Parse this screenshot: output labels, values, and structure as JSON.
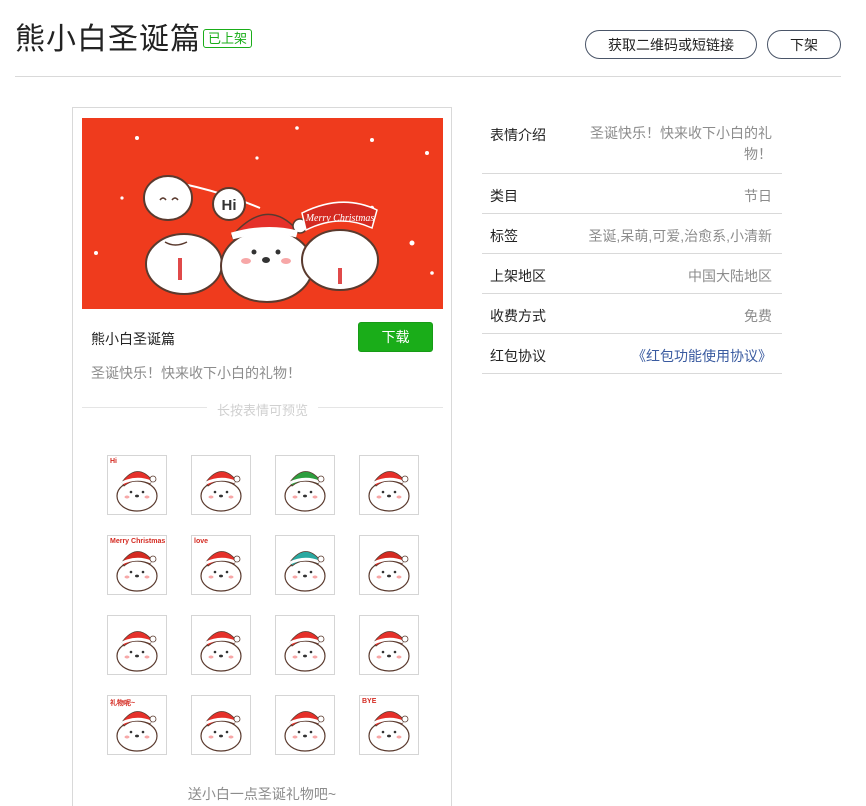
{
  "header": {
    "title": "熊小白圣诞篇",
    "status": "已上架",
    "qrcode_button": "获取二维码或短链接",
    "offline_button": "下架"
  },
  "card": {
    "banner": {
      "bubble_text": "Hi",
      "ribbon_text": "Merry Christmas",
      "background_color": "#ef3b1d"
    },
    "pack_name": "熊小白圣诞篇",
    "download_button": "下载",
    "description": "圣诞快乐！快来收下小白的礼物！",
    "preview_hint": "长按表情可预览",
    "footer_note": "送小白一点圣诞礼物吧~",
    "stickers": [
      {
        "name": "sticker-hi-bear-icon",
        "text": "Hi"
      },
      {
        "name": "sticker-gift-bear-icon",
        "text": ""
      },
      {
        "name": "sticker-tree-bear-icon",
        "text": ""
      },
      {
        "name": "sticker-reindeer-bear-icon",
        "text": ""
      },
      {
        "name": "sticker-merry-christmas-bear-icon",
        "text": "Merry Christmas"
      },
      {
        "name": "sticker-love-balloon-bear-icon",
        "text": "love"
      },
      {
        "name": "sticker-scarf-bear-icon",
        "text": ""
      },
      {
        "name": "sticker-santa-bear-icon",
        "text": ""
      },
      {
        "name": "sticker-antler-bear-icon",
        "text": ""
      },
      {
        "name": "sticker-antler-sign-bear-icon",
        "text": ""
      },
      {
        "name": "sticker-sleeping-bag-bear-icon",
        "text": ""
      },
      {
        "name": "sticker-dots-bear-icon",
        "text": ""
      },
      {
        "name": "sticker-thanks-bear-icon",
        "text": "礼物呢~"
      },
      {
        "name": "sticker-reindeer-nose-bear-icon",
        "text": ""
      },
      {
        "name": "sticker-ornament-bear-icon",
        "text": ""
      },
      {
        "name": "sticker-bye-bear-icon",
        "text": "BYE"
      }
    ]
  },
  "info": {
    "rows": [
      {
        "label": "表情介绍",
        "value": "圣诞快乐！快来收下小白的礼物！"
      },
      {
        "label": "类目",
        "value": "节日"
      },
      {
        "label": "标签",
        "value": "圣诞,呆萌,可爱,治愈系,小清新"
      },
      {
        "label": "上架地区",
        "value": "中国大陆地区"
      },
      {
        "label": "收费方式",
        "value": "免费"
      },
      {
        "label": "红包协议",
        "value": "《红包功能使用协议》"
      }
    ]
  },
  "colors": {
    "accent_green": "#1aad19",
    "link_blue": "#3a5ba0",
    "banner_red": "#ef3b1d"
  }
}
